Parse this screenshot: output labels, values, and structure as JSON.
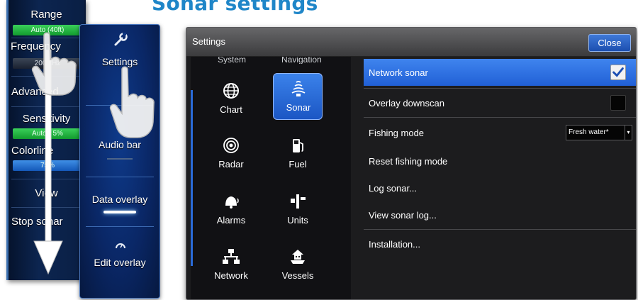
{
  "heading": "Sonar settings",
  "side_menu": {
    "range_label": "Range",
    "range_value": "Auto (40ft)",
    "frequency_label": "Frequency",
    "frequency_value": "200 kHz",
    "advanced_label": "Advanced",
    "sensitivity_label": "Sensitivity",
    "sensitivity_value": "Auto - 5%",
    "colorline_label": "Colorline",
    "colorline_value": "75%",
    "view_label": "View",
    "stop_label": "Stop sonar"
  },
  "context_menu": {
    "settings_label": "Settings",
    "audio_bar_label": "Audio bar",
    "data_overlay_label": "Data overlay",
    "edit_overlay_label": "Edit overlay"
  },
  "dialog": {
    "title": "Settings",
    "close_label": "Close",
    "cutoff_labels": [
      "System",
      "Navigation"
    ],
    "categories": [
      {
        "label": "Chart",
        "icon": "globe-icon"
      },
      {
        "label": "Sonar",
        "icon": "sonar-icon"
      },
      {
        "label": "Radar",
        "icon": "radar-icon"
      },
      {
        "label": "Fuel",
        "icon": "fuel-pump-icon"
      },
      {
        "label": "Alarms",
        "icon": "alarm-bell-icon"
      },
      {
        "label": "Units",
        "icon": "units-icon"
      },
      {
        "label": "Network",
        "icon": "network-icon"
      },
      {
        "label": "Vessels",
        "icon": "vessels-icon"
      }
    ],
    "selected_category": "Sonar",
    "options": [
      {
        "label": "Network sonar",
        "checked": true
      },
      {
        "label": "Overlay downscan",
        "checked": false
      },
      {
        "label": "Fishing mode",
        "value": "Fresh water*"
      },
      {
        "label": "Reset fishing mode"
      },
      {
        "label": "Log sonar..."
      },
      {
        "label": "View sonar log..."
      },
      {
        "label": "Installation..."
      }
    ]
  },
  "colors": {
    "heading": "#1f86c8",
    "accent_blue": "#2160d6",
    "gauge_green": "#129a2e",
    "gauge_blue": "#1458b8"
  }
}
